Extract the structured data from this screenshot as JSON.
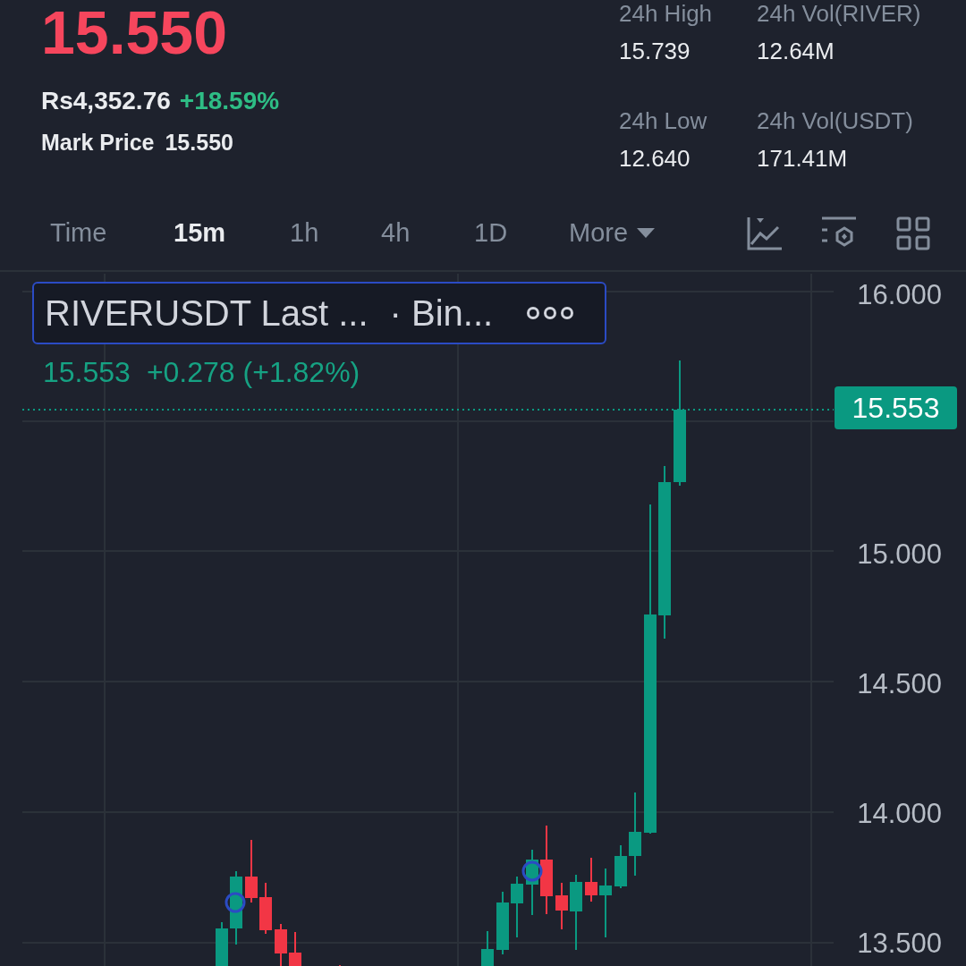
{
  "header": {
    "price": "15.550",
    "fiat_value": "Rs4,352.76",
    "change": "+18.59%",
    "mark_price_label": "Mark Price",
    "mark_price": "15.550"
  },
  "stats": [
    {
      "label": "24h High",
      "value": "15.739"
    },
    {
      "label": "24h Vol(RIVER)",
      "value": "12.64M"
    },
    {
      "label": "24h Low",
      "value": "12.640"
    },
    {
      "label": "24h Vol(USDT)",
      "value": "171.41M"
    }
  ],
  "tabs": [
    {
      "label": "Time",
      "selected": false,
      "kind": "plain"
    },
    {
      "label": "15m",
      "selected": true,
      "kind": "plain"
    },
    {
      "label": "1h",
      "selected": false,
      "kind": "plain"
    },
    {
      "label": "4h",
      "selected": false,
      "kind": "plain"
    },
    {
      "label": "1D",
      "selected": false,
      "kind": "plain"
    },
    {
      "label": "More",
      "selected": false,
      "kind": "dropdown"
    }
  ],
  "chart": {
    "legend_title": "RIVERUSDT Last ...",
    "legend_source": "· Bin...",
    "last_value": "15.553",
    "last_change": "+0.278 (+1.82%)",
    "price_tag": "15.553",
    "y_axis": [
      "16.000",
      "15.000",
      "14.500",
      "14.000",
      "13.500"
    ]
  }
}
